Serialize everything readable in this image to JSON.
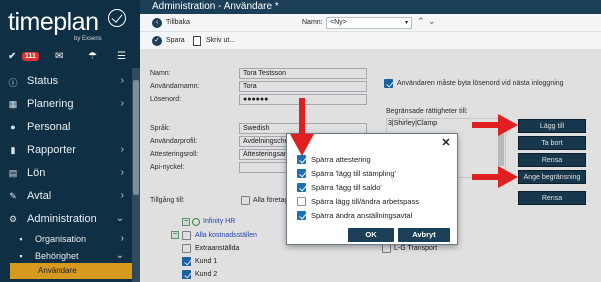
{
  "brand": {
    "logo_text": "timeplan",
    "logo_sub": "by Exsens"
  },
  "icon_bar": {
    "check_icon": "check-icon",
    "badge_count": "111",
    "mail_icon": "mail-icon",
    "umbrella_icon": "umbrella-icon",
    "list_icon": "list-icon"
  },
  "nav": {
    "items": [
      {
        "label": "Status",
        "icon": "info-icon"
      },
      {
        "label": "Planering",
        "icon": "calendar-icon"
      },
      {
        "label": "Personal",
        "icon": "person-icon"
      },
      {
        "label": "Rapporter",
        "icon": "chart-icon"
      },
      {
        "label": "Lön",
        "icon": "file-icon"
      },
      {
        "label": "Avtal",
        "icon": "wrench-icon"
      },
      {
        "label": "Administration",
        "icon": "cogs-icon"
      }
    ],
    "subitems": [
      {
        "label": "Organisation"
      },
      {
        "label": "Behörighet"
      }
    ],
    "active": "Användare"
  },
  "header": {
    "title": "Administration - Användare *"
  },
  "toolbar": {
    "back_label": "Tillbaka",
    "name_label": "Namn:",
    "name_value": "<Ny>",
    "save_label": "Spara",
    "print_label": "Skriv ut..."
  },
  "form": {
    "name_label": "Namn:",
    "name_value": "Tora Testsson",
    "username_label": "Användarnamn:",
    "username_value": "Tora",
    "password_label": "Lösenord:",
    "password_value": "●●●●●●",
    "language_label": "Språk:",
    "language_value": "Swedish",
    "profile_label": "Användarprofil:",
    "profile_value": "Avdelningschef",
    "attest_label": "Attesteringsroll:",
    "attest_value": "Attesteringsansvarig",
    "api_label": "Api-nyckel:",
    "access_label": "Tillgång till:",
    "all_companies": "Alla företag",
    "must_change_pw": "Användaren måste byta lösenord vid nästa inloggning",
    "restricted_label": "Begränsade rättigheter till:",
    "restricted_value": "3|Shirley|Clamp"
  },
  "tree": {
    "root": "Infinity HR",
    "all_cost": "Alla kostnadsställen",
    "extra": "Extraanställda",
    "kund1": "Kund 1",
    "kund2": "Kund 2",
    "lg": "L-G Transport"
  },
  "side_buttons": {
    "add": "Lägg till",
    "remove": "Ta bort",
    "clear": "Rensa",
    "restrict": "Ange begränsning",
    "clear2": "Rensa"
  },
  "dialog": {
    "options": [
      {
        "label": "Spärra attestering",
        "checked": true
      },
      {
        "label": "Spärra 'lägg till stämpling'",
        "checked": true
      },
      {
        "label": "Spärra 'lägg till saldo'",
        "checked": true
      },
      {
        "label": "Spärra lägg till/ändra arbetspass",
        "checked": false
      },
      {
        "label": "Spärra ändra anställningsavtal",
        "checked": true
      }
    ],
    "ok_label": "OK",
    "cancel_label": "Avbryt"
  },
  "colors": {
    "sidebar": "#0f2f44",
    "accent": "#d79a1e",
    "button": "#1b3f57",
    "arrow": "#e02020",
    "checkbox": "#1d6fb8"
  }
}
